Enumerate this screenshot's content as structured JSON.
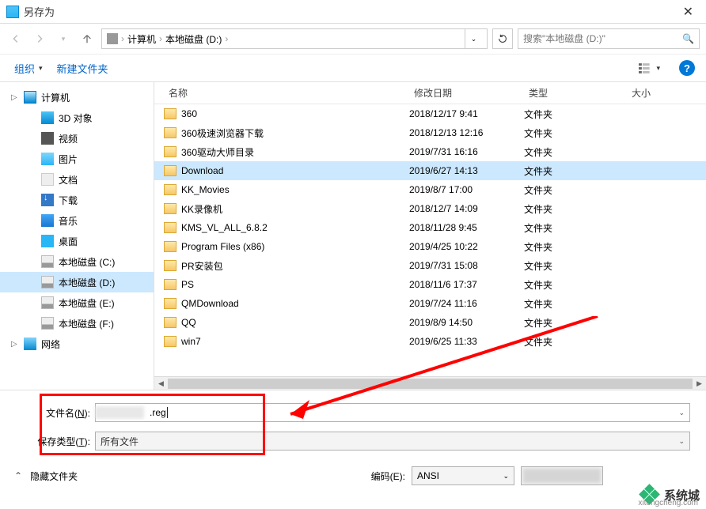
{
  "window": {
    "title": "另存为"
  },
  "nav": {
    "breadcrumb": {
      "root_icon": "drive-icon",
      "seg1": "计算机",
      "seg2": "本地磁盘 (D:)"
    },
    "search_placeholder": "搜索\"本地磁盘 (D:)\"",
    "refresh_icon": "refresh-icon"
  },
  "toolbar": {
    "organize": "组织",
    "new_folder": "新建文件夹",
    "view_icon": "view-list-icon",
    "help_icon": "?"
  },
  "sidebar": {
    "items": [
      {
        "label": "计算机",
        "icon": "ico-computer",
        "level": 0,
        "expandable": true
      },
      {
        "label": "3D 对象",
        "icon": "ico-3d",
        "level": 1
      },
      {
        "label": "视频",
        "icon": "ico-video",
        "level": 1
      },
      {
        "label": "图片",
        "icon": "ico-pic",
        "level": 1
      },
      {
        "label": "文档",
        "icon": "ico-doc",
        "level": 1
      },
      {
        "label": "下载",
        "icon": "ico-download",
        "level": 1
      },
      {
        "label": "音乐",
        "icon": "ico-music",
        "level": 1
      },
      {
        "label": "桌面",
        "icon": "ico-desktop",
        "level": 1
      },
      {
        "label": "本地磁盘 (C:)",
        "icon": "ico-disk",
        "level": 1
      },
      {
        "label": "本地磁盘 (D:)",
        "icon": "ico-disk",
        "level": 1,
        "selected": true
      },
      {
        "label": "本地磁盘 (E:)",
        "icon": "ico-disk",
        "level": 1
      },
      {
        "label": "本地磁盘 (F:)",
        "icon": "ico-disk",
        "level": 1
      },
      {
        "label": "网络",
        "icon": "ico-network",
        "level": 0,
        "expandable": true
      }
    ]
  },
  "filelist": {
    "columns": {
      "name": "名称",
      "date": "修改日期",
      "type": "类型",
      "size": "大小"
    },
    "rows": [
      {
        "name": "360",
        "date": "2018/12/17 9:41",
        "type": "文件夹"
      },
      {
        "name": "360极速浏览器下载",
        "date": "2018/12/13 12:16",
        "type": "文件夹"
      },
      {
        "name": "360驱动大师目录",
        "date": "2019/7/31 16:16",
        "type": "文件夹"
      },
      {
        "name": "Download",
        "date": "2019/6/27 14:13",
        "type": "文件夹",
        "selected": true
      },
      {
        "name": "KK_Movies",
        "date": "2019/8/7 17:00",
        "type": "文件夹"
      },
      {
        "name": "KK录像机",
        "date": "2018/12/7 14:09",
        "type": "文件夹"
      },
      {
        "name": "KMS_VL_ALL_6.8.2",
        "date": "2018/11/28 9:45",
        "type": "文件夹"
      },
      {
        "name": "Program Files (x86)",
        "date": "2019/4/25 10:22",
        "type": "文件夹"
      },
      {
        "name": "PR安装包",
        "date": "2019/7/31 15:08",
        "type": "文件夹"
      },
      {
        "name": "PS",
        "date": "2018/11/6 17:37",
        "type": "文件夹"
      },
      {
        "name": "QMDownload",
        "date": "2019/7/24 11:16",
        "type": "文件夹"
      },
      {
        "name": "QQ",
        "date": "2019/8/9 14:50",
        "type": "文件夹"
      },
      {
        "name": "win7",
        "date": "2019/6/25 11:33",
        "type": "文件夹"
      }
    ]
  },
  "form": {
    "filename_label": "文件名(N):",
    "filename_value": ".reg",
    "filetype_label": "保存类型(T):",
    "filetype_value": "所有文件"
  },
  "footer": {
    "hide_folders": "隐藏文件夹",
    "encoding_label": "编码(E):",
    "encoding_value": "ANSI"
  },
  "watermark": {
    "brand": "系统城",
    "url": "xitongcheng.com"
  }
}
